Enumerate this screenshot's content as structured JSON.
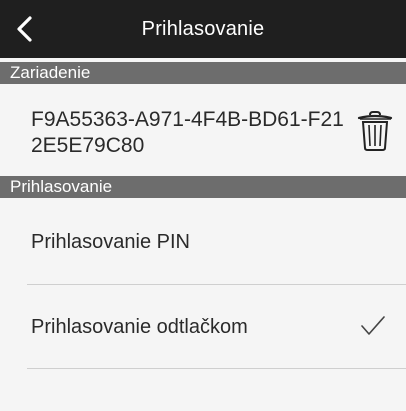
{
  "navbar": {
    "title": "Prihlasovanie",
    "back_icon": "chevron-left-icon"
  },
  "section_device": {
    "header": "Zariadenie",
    "device_id": "F9A55363-A971-4F4B-BD61-F212E5E79C80",
    "delete_icon": "trash-icon"
  },
  "section_login": {
    "header": "Prihlasovanie",
    "items": [
      {
        "label": "Prihlasovanie PIN",
        "selected": false
      },
      {
        "label": "Prihlasovanie odtlačkom",
        "selected": true
      }
    ]
  },
  "colors": {
    "navbar_bg": "#1f1f1f",
    "section_header_bg": "#6d6d6d",
    "background": "#f5f5f5",
    "divider": "#cfcfcf"
  }
}
